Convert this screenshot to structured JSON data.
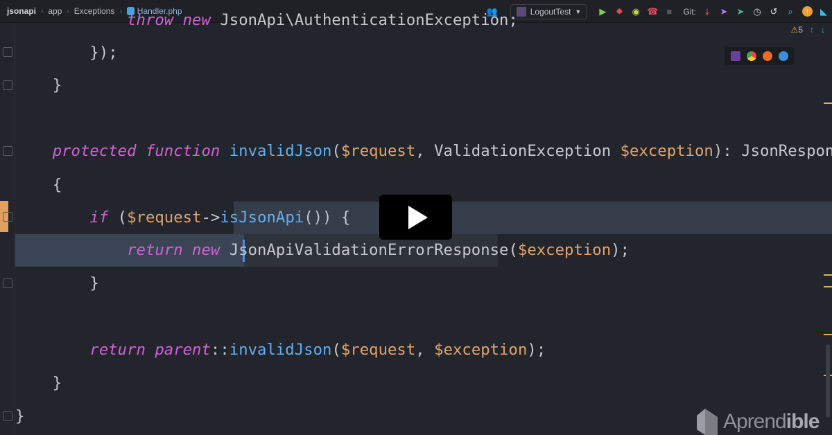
{
  "breadcrumb": [
    "jsonapi",
    "app",
    "Exceptions",
    "Handler.php"
  ],
  "toolbar": {
    "run_config": "LogoutTest",
    "git_label": "Git:"
  },
  "inspections": {
    "warning_count": "5"
  },
  "code_lines": [
    [
      [
        "k",
        "throw new "
      ],
      [
        "t",
        "JsonApi\\AuthenticationException;"
      ]
    ],
    [
      [
        "t",
        "});"
      ]
    ],
    [
      [
        "t",
        "}"
      ]
    ],
    [
      [
        "k",
        "protected function "
      ],
      [
        "f",
        "invalidJson"
      ],
      [
        "t",
        "("
      ],
      [
        "v",
        "$request"
      ],
      [
        "t",
        ", ValidationException "
      ],
      [
        "v",
        "$exception"
      ],
      [
        "t",
        "): JsonResponse"
      ]
    ],
    [
      [
        "t",
        "{"
      ]
    ],
    [
      [
        "k",
        "if "
      ],
      [
        "t",
        "("
      ],
      [
        "v",
        "$request"
      ],
      [
        "t",
        "->"
      ],
      [
        "f",
        "isJsonApi"
      ],
      [
        "t",
        "()) {"
      ]
    ],
    [
      [
        "k",
        "return new "
      ],
      [
        "t",
        "JsonApiValidationErrorResponse("
      ],
      [
        "v",
        "$exception"
      ],
      [
        "t",
        ");"
      ]
    ],
    [
      [
        "t",
        "}"
      ]
    ],
    [
      [
        "k",
        "return "
      ],
      [
        "k",
        "parent"
      ],
      [
        "t",
        "::"
      ],
      [
        "f",
        "invalidJson"
      ],
      [
        "t",
        "("
      ],
      [
        "v",
        "$request"
      ],
      [
        "t",
        ", "
      ],
      [
        "v",
        "$exception"
      ],
      [
        "t",
        ");"
      ]
    ],
    [
      [
        "t",
        "}"
      ]
    ],
    [
      [
        "t",
        "}"
      ]
    ]
  ],
  "watermark": {
    "brand": "Aprendible"
  },
  "colors": {
    "keyword": "#d160d6",
    "variable": "#e0a36c",
    "function": "#62aef0",
    "background": "#23252c"
  }
}
